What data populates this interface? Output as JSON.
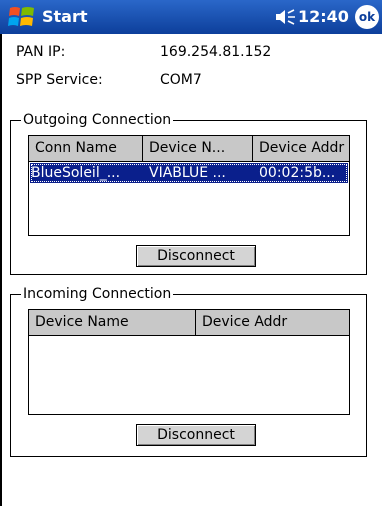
{
  "titlebar": {
    "title": "Start",
    "time": "12:40",
    "ok_label": "ok"
  },
  "info": {
    "pan_ip_label": "PAN IP:",
    "pan_ip_value": "169.254.81.152",
    "spp_label": "SPP Service:",
    "spp_value": "COM7"
  },
  "outgoing": {
    "title": "Outgoing Connection",
    "columns": [
      "Conn  Name",
      "Device N...",
      "Device Addr"
    ],
    "rows": [
      {
        "conn_name": "BlueSoleil_...",
        "device_name": "VIABLUE ...",
        "device_addr": "00:02:5b..."
      }
    ],
    "disconnect_label": "Disconnect"
  },
  "incoming": {
    "title": "Incoming Connection",
    "columns": [
      "Device Name",
      "Device Addr"
    ],
    "disconnect_label": "Disconnect"
  },
  "colors": {
    "titlebar": "#0d3f9b",
    "selection": "#0a1f8c"
  }
}
